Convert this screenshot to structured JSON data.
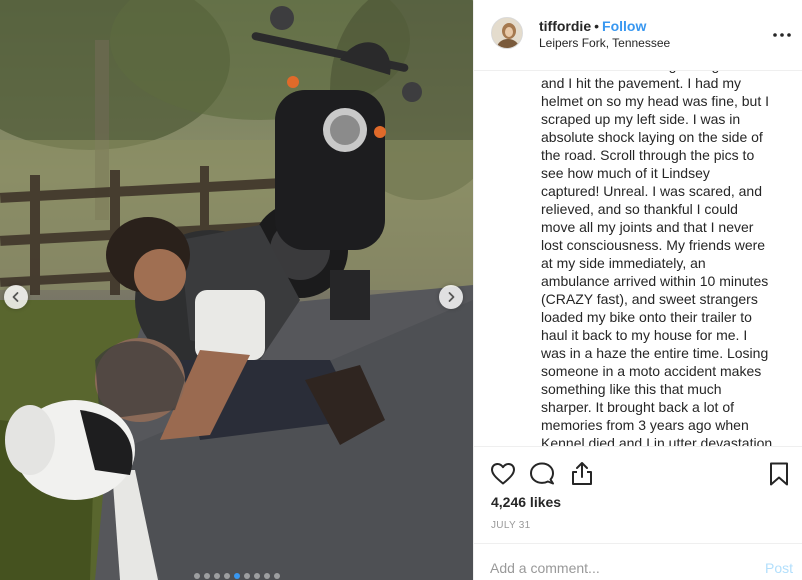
{
  "post": {
    "username": "tiffordie",
    "bullet": "•",
    "follow_label": "Follow",
    "location": "Leipers Fork, Tennessee",
    "caption_lines": [
      "the road. It slid through the grass",
      "and I hit the pavement. I had my",
      "helmet on so my head was fine, but I",
      "scraped up my left side. I was in",
      "absolute shock laying on the side of",
      "the road. Scroll through the pics to",
      "see how much of it Lindsey",
      "captured! Unreal. I was scared, and",
      "relieved, and so thankful I could",
      "move all my joints and that I never",
      "lost consciousness. My friends were",
      "at my side immediately, an",
      "ambulance arrived within 10 minutes",
      "(CRAZY fast), and sweet strangers",
      "loaded my bike onto their trailer to",
      "haul it back to my house for me. I",
      "was in a haze the entire time. Losing",
      "someone in a moto accident makes",
      "something like this that much",
      "sharper. It brought back a lot of",
      "memories from 3 years ago when",
      "Kennel died and I in utter devastation"
    ],
    "likes": "4,246 likes",
    "date": "JULY 31",
    "comment_placeholder": "Add a comment...",
    "post_label": "Post"
  },
  "carousel": {
    "slide_count": 9,
    "active_index": 4
  },
  "colors": {
    "link_blue": "#3897f0",
    "post_disabled": "#b2dffc",
    "muted_text": "#999999",
    "divider": "#efefef"
  },
  "icons": {
    "prev": "chevron-left-icon",
    "next": "chevron-right-icon",
    "more": "more-options-icon",
    "like": "heart-icon",
    "comment": "comment-bubble-icon",
    "share": "share-upload-icon",
    "save": "bookmark-icon"
  }
}
